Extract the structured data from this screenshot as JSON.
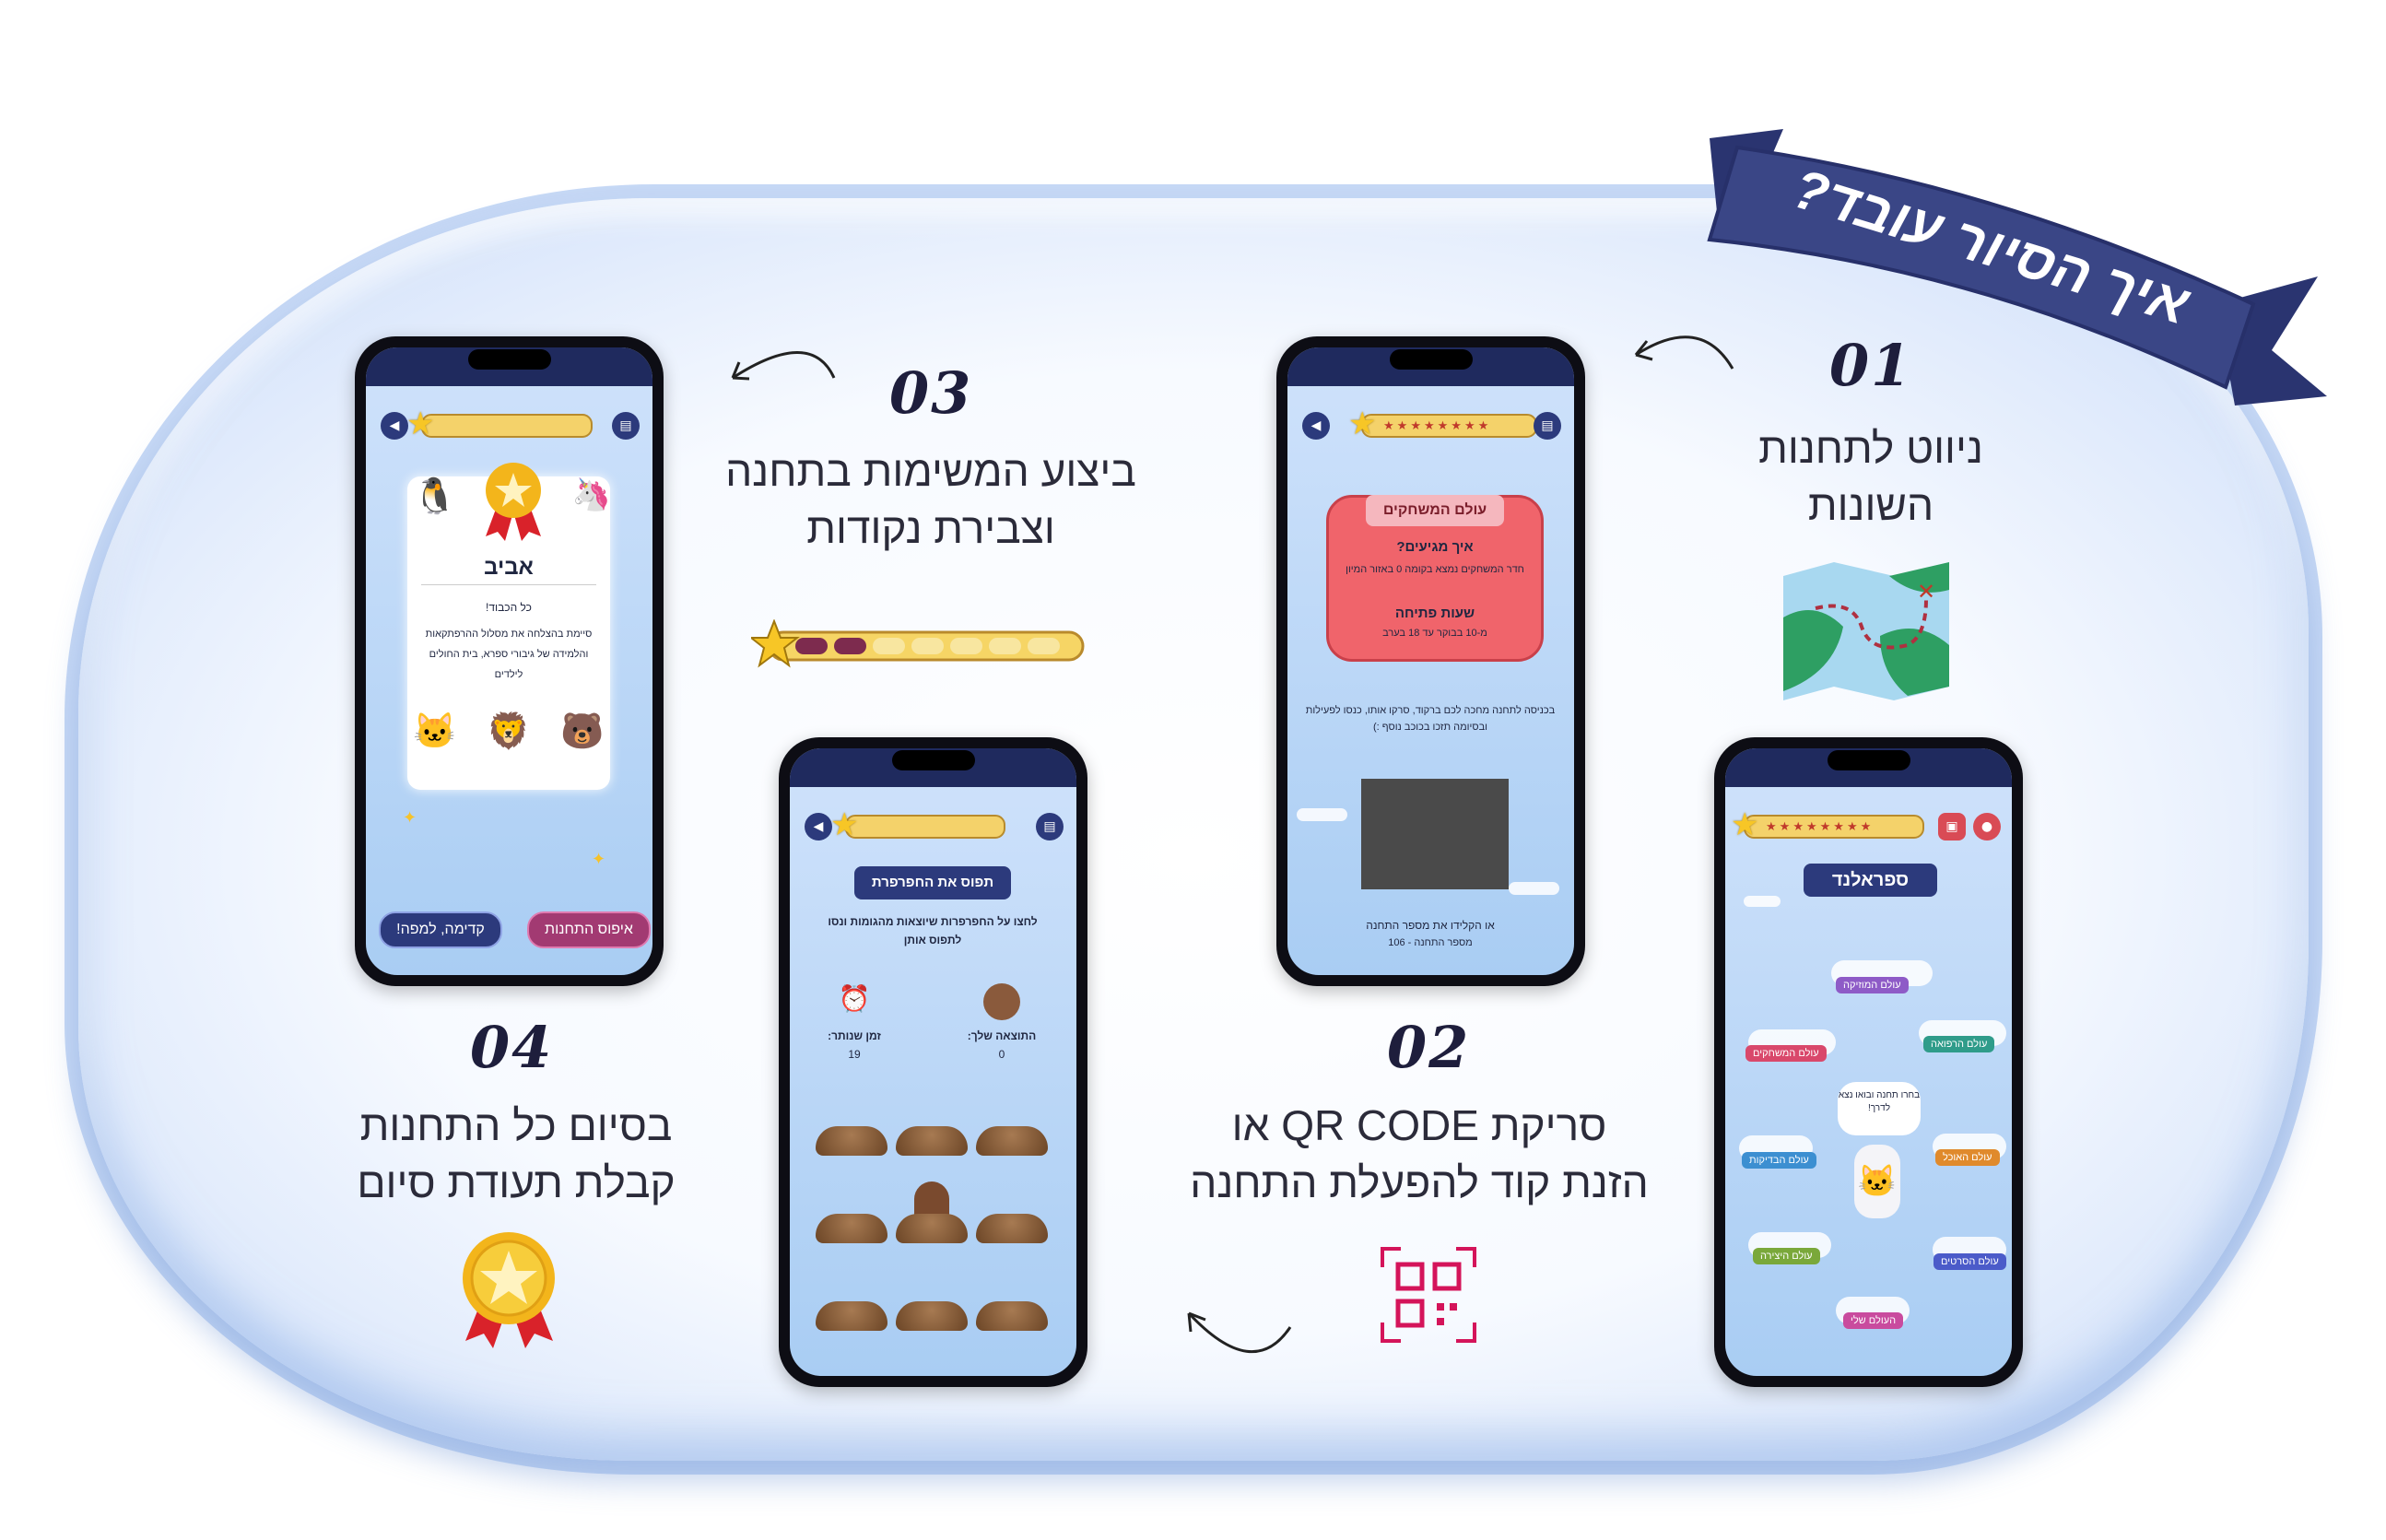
{
  "ribbon": {
    "title": "איך הסיור עובד?"
  },
  "steps": [
    {
      "num": "01",
      "line1": "ניווט לתחנות",
      "line2": "השונות"
    },
    {
      "num": "02",
      "line1": "סריקת QR CODE או",
      "line2": "הזנת קוד להפעלת התחנה"
    },
    {
      "num": "03",
      "line1": "ביצוע המשימות בתחנה",
      "line2": "וצבירת נקודות"
    },
    {
      "num": "04",
      "line1": "בסיום כל התחנות",
      "line2": "קבלת תעודת סיום"
    }
  ],
  "phone_map": {
    "title": "ספראלנד",
    "bubble": "בחרו תחנה ובואו נצא לדרך!",
    "worlds": [
      {
        "label": "עולם המוזיקה",
        "color": "#8e5bc7"
      },
      {
        "label": "עולם המשחקים",
        "color": "#d9486b"
      },
      {
        "label": "עולם הרפואה",
        "color": "#2f9c8a"
      },
      {
        "label": "עולם הבדיקות",
        "color": "#3c8fd1"
      },
      {
        "label": "עולם האוכל",
        "color": "#e08a2c"
      },
      {
        "label": "עולם היצירה",
        "color": "#7aa83a"
      },
      {
        "label": "עולם הסרטים",
        "color": "#4b5bc9"
      },
      {
        "label": "העולם שלי",
        "color": "#c94b9e"
      }
    ]
  },
  "phone_station": {
    "title": "עולם המשחקים",
    "how_title": "איך מגיעים?",
    "how_text": "חדר המשחקים נמצא בקומה 0 באזור המיון",
    "hours_title": "שעות פתיחה",
    "hours_text": "מ-10 בבוקר עד 18 בערב",
    "instructions": "בכניסה לתחנה מחכה לכם ברקוד, סרקו אותו, כנסו לפעילות ובסיומה תזכו בכוכב נוסף :)",
    "code_prompt": "או הקלידו את מספר התחנה",
    "station_number": "מספר התחנה - 106"
  },
  "phone_game": {
    "banner": "תפוס את החפרפרת",
    "instructions": "לחצו על החפרפרות שיוצאות מהגומות ונסו לתפוס אותן",
    "time_label": "זמן שנותר:",
    "time_value": "19",
    "score_label": "התוצאה שלך:",
    "score_value": "0"
  },
  "phone_cert": {
    "name": "אביב",
    "greeting": "כל הכבוד!",
    "body": "סיימת בהצלחה את מסלול ההרפתקאות והלמידה של גיבורי ספרא, בית החולים לילדים",
    "btn_reset": "איפוס התחנות",
    "btn_map": "קדימה, למפה!"
  },
  "colors": {
    "navy": "#2c3a7c",
    "ribbon": "#34407e",
    "qr_magenta": "#d4145a",
    "station_card": "#f0646b"
  },
  "icons": [
    "map-icon",
    "qr-code-icon",
    "progress-bar-icon",
    "medal-icon"
  ]
}
